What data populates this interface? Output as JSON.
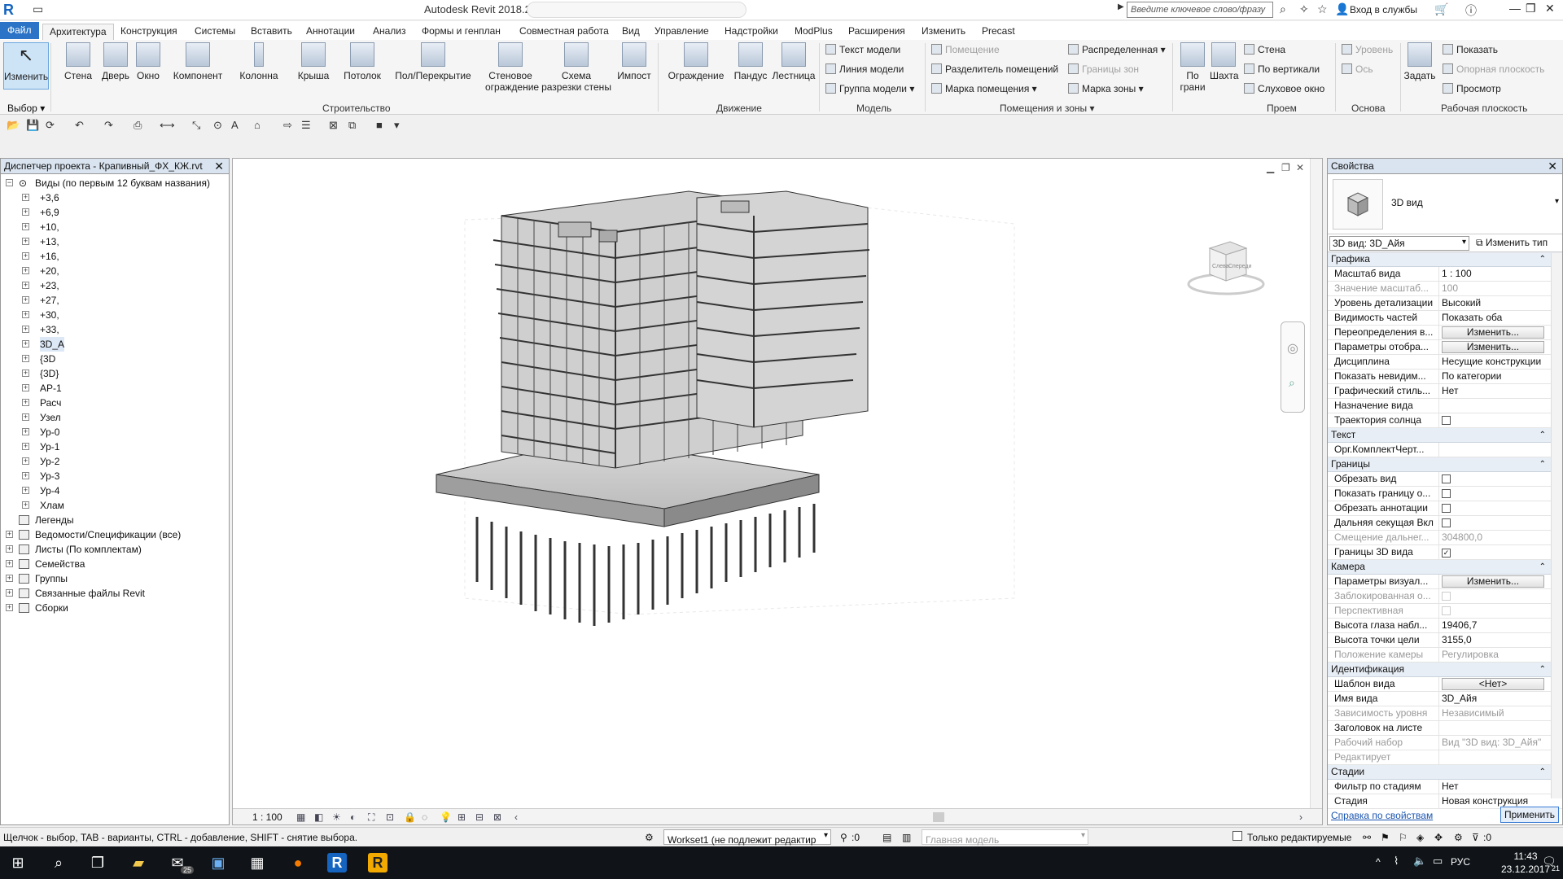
{
  "app": {
    "logo": "R",
    "title": "Autodesk Revit 2018.2 -",
    "search_placeholder": "Введите ключевое слово/фразу",
    "login": "Вход в службы"
  },
  "tabs": [
    "Файл",
    "Архитектура",
    "Конструкция",
    "Системы",
    "Вставить",
    "Аннотации",
    "Анализ",
    "Формы и генплан",
    "Совместная работа",
    "Вид",
    "Управление",
    "Надстройки",
    "ModPlus",
    "Расширения",
    "Изменить",
    "Precast"
  ],
  "ribbon": {
    "select_label": "Выбор",
    "buttons": [
      {
        "label": "Изменить"
      },
      {
        "label": "Стена"
      },
      {
        "label": "Дверь"
      },
      {
        "label": "Окно"
      },
      {
        "label": "Компонент"
      },
      {
        "label": "Колонна"
      },
      {
        "label": "Крыша"
      },
      {
        "label": "Потолок"
      },
      {
        "label": "Пол/Перекрытие"
      },
      {
        "label": "Стеновое ограждение"
      },
      {
        "label": "Схема разрезки стены"
      },
      {
        "label": "Импост"
      },
      {
        "label": "Ограждение"
      },
      {
        "label": "Пандус"
      },
      {
        "label": "Лестница"
      },
      {
        "label": "По грани"
      },
      {
        "label": "Шахта"
      },
      {
        "label": "Задать"
      }
    ],
    "small": [
      {
        "label": "Текст модели"
      },
      {
        "label": "Линия модели"
      },
      {
        "label": "Группа модели"
      },
      {
        "label": "Помещение"
      },
      {
        "label": "Разделитель помещений"
      },
      {
        "label": "Марка помещения"
      },
      {
        "label": "Распределенная"
      },
      {
        "label": "Границы зон"
      },
      {
        "label": "Марка зоны"
      },
      {
        "label": "Стена"
      },
      {
        "label": "По вертикали"
      },
      {
        "label": "Слуховое окно"
      },
      {
        "label": "Уровень"
      },
      {
        "label": "Ось"
      },
      {
        "label": "Показать"
      },
      {
        "label": "Опорная плоскость"
      },
      {
        "label": "Просмотр"
      }
    ],
    "panels": [
      "Строительство",
      "Движение",
      "Модель",
      "Помещения и зоны",
      "Проем",
      "Основа",
      "Рабочая плоскость"
    ]
  },
  "browser": {
    "title": "Диспетчер проекта - Крапивный_ФХ_КЖ.rvt",
    "root": "Виды (по первым 12 буквам названия)",
    "views": [
      "+3,6",
      "+6,9",
      "+10,",
      "+13,",
      "+16,",
      "+20,",
      "+23,",
      "+27,",
      "+30,",
      "+33,",
      "3D_А",
      "{3D",
      "{3D}",
      "АР-1",
      "Расч",
      "Узел",
      "Ур-0",
      "Ур-1",
      "Ур-2",
      "Ур-3",
      "Ур-4",
      "Хлам"
    ],
    "groups": [
      "Легенды",
      "Ведомости/Спецификации (все)",
      "Листы (По комплектам)",
      "Семейства",
      "Группы",
      "Связанные файлы Revit",
      "Сборки"
    ]
  },
  "viewport": {
    "scale": "1 : 100",
    "viewcube_left": "Слева",
    "viewcube_front": "Спереди"
  },
  "properties": {
    "title": "Свойства",
    "type_name": "3D вид",
    "instance": "3D вид: 3D_Айя",
    "edit_type": "Изменить тип",
    "groups": [
      {
        "name": "Графика",
        "rows": [
          {
            "k": "Масштаб вида",
            "v": "1 : 100",
            "type": "text"
          },
          {
            "k": "Значение масштаб...",
            "v": "100",
            "type": "text",
            "dis": true
          },
          {
            "k": "Уровень детализации",
            "v": "Высокий",
            "type": "text"
          },
          {
            "k": "Видимость частей",
            "v": "Показать оба",
            "type": "text"
          },
          {
            "k": "Переопределения в...",
            "v": "Изменить...",
            "type": "btn"
          },
          {
            "k": "Параметры отобра...",
            "v": "Изменить...",
            "type": "btn"
          },
          {
            "k": "Дисциплина",
            "v": "Несущие конструкции",
            "type": "text"
          },
          {
            "k": "Показать невидим...",
            "v": "По категории",
            "type": "text"
          },
          {
            "k": "Графический стиль...",
            "v": "Нет",
            "type": "text"
          },
          {
            "k": "Назначение вида",
            "v": "",
            "type": "text"
          },
          {
            "k": "Траектория солнца",
            "v": "",
            "type": "chk"
          }
        ]
      },
      {
        "name": "Текст",
        "rows": [
          {
            "k": "Орг.КомплектЧерт...",
            "v": "",
            "type": "text"
          }
        ]
      },
      {
        "name": "Границы",
        "rows": [
          {
            "k": "Обрезать вид",
            "v": "",
            "type": "chk"
          },
          {
            "k": "Показать границу о...",
            "v": "",
            "type": "chk"
          },
          {
            "k": "Обрезать аннотации",
            "v": "",
            "type": "chk"
          },
          {
            "k": "Дальняя секущая Вкл",
            "v": "",
            "type": "chk"
          },
          {
            "k": "Смещение дальнег...",
            "v": "304800,0",
            "type": "text",
            "dis": true
          },
          {
            "k": "Границы 3D вида",
            "v": "✓",
            "type": "chk"
          }
        ]
      },
      {
        "name": "Камера",
        "rows": [
          {
            "k": "Параметры визуал...",
            "v": "Изменить...",
            "type": "btn"
          },
          {
            "k": "Заблокированная о...",
            "v": "",
            "type": "chk",
            "dis": true
          },
          {
            "k": "Перспективная",
            "v": "",
            "type": "chk",
            "dis": true
          },
          {
            "k": "Высота глаза набл...",
            "v": "19406,7",
            "type": "text"
          },
          {
            "k": "Высота точки цели",
            "v": "3155,0",
            "type": "text"
          },
          {
            "k": "Положение камеры",
            "v": "Регулировка",
            "type": "text",
            "dis": true
          }
        ]
      },
      {
        "name": "Идентификация",
        "rows": [
          {
            "k": "Шаблон вида",
            "v": "<Нет>",
            "type": "btn"
          },
          {
            "k": "Имя вида",
            "v": "3D_Айя",
            "type": "text"
          },
          {
            "k": "Зависимость уровня",
            "v": "Независимый",
            "type": "text",
            "dis": true
          },
          {
            "k": "Заголовок на листе",
            "v": "",
            "type": "text"
          },
          {
            "k": "Рабочий набор",
            "v": "Вид \"3D вид: 3D_Айя\"",
            "type": "text",
            "dis": true
          },
          {
            "k": "Редактирует",
            "v": "",
            "type": "text",
            "dis": true
          }
        ]
      },
      {
        "name": "Стадии",
        "rows": [
          {
            "k": "Фильтр по стадиям",
            "v": "Нет",
            "type": "text"
          },
          {
            "k": "Стадия",
            "v": "Новая конструкция",
            "type": "text"
          }
        ]
      }
    ],
    "help": "Справка по свойствам",
    "apply": "Применить"
  },
  "status": {
    "hint": "Щелчок - выбор, TAB - варианты, CTRL - добавление, SHIFT - снятие выбора.",
    "workset": "Workset1 (не подлежит редактир",
    "count": ":0",
    "model": "Главная модель",
    "editable_only": "Только редактируемые",
    "filter_count": ":0"
  },
  "taskbar": {
    "mail_badge": "25",
    "lang": "РУС",
    "time": "11:43",
    "date": "23.12.2017",
    "notif": "21"
  }
}
